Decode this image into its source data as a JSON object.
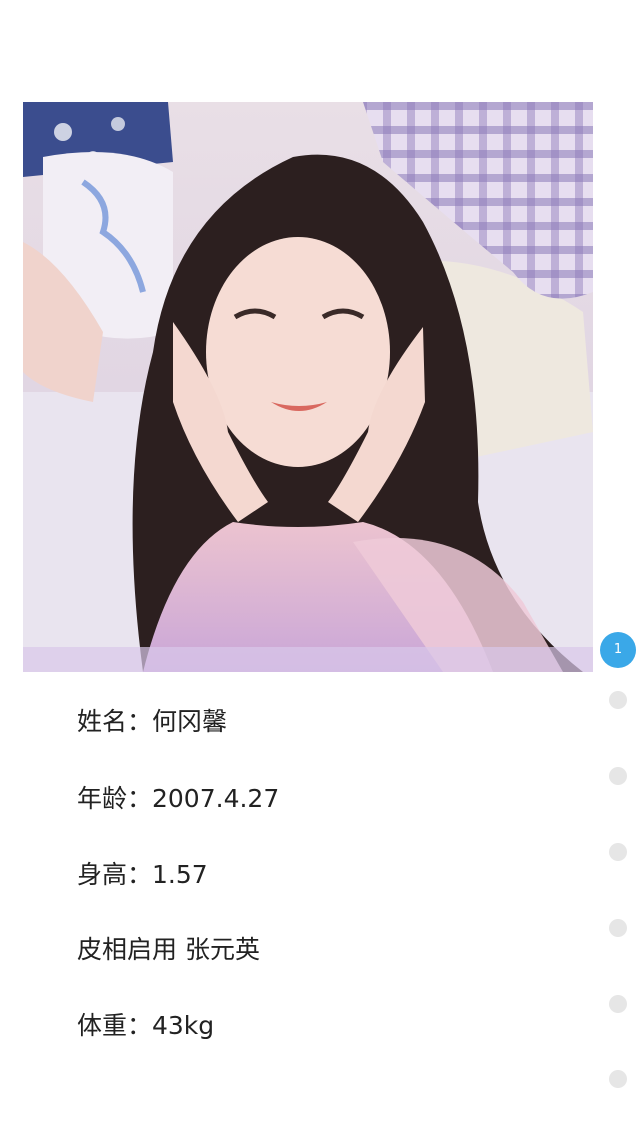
{
  "photo": {
    "description_icon": "portrait-photo"
  },
  "info": {
    "name_line": "姓名：何冈馨",
    "age_line": "年龄：2007.4.27",
    "height_line": "身高：1.57",
    "face_line": "皮相启用 张元英",
    "weight_line": "体重：43kg"
  },
  "pager": {
    "current_page": "1",
    "total_dots": 7,
    "active_color": "#3aa8e8",
    "inactive_color": "#e6e6e6"
  }
}
